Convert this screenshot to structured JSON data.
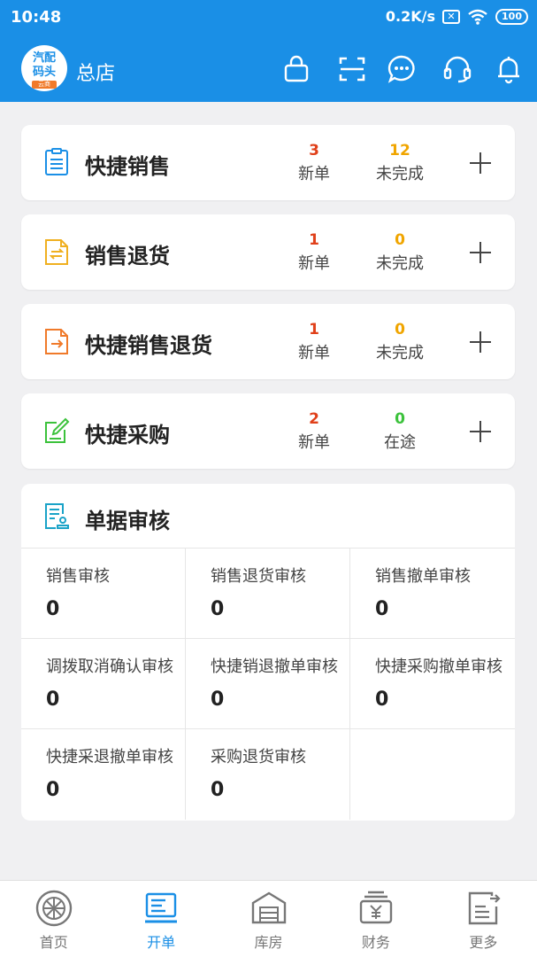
{
  "status_bar": {
    "time": "10:48",
    "net_speed": "0.2K/s",
    "battery": "100"
  },
  "header": {
    "logo": {
      "line1": "汽配",
      "line2": "码头",
      "band": "云商"
    },
    "store_name": "总店",
    "icons": [
      "bag-icon",
      "scan-icon",
      "message-icon",
      "headset-icon",
      "bell-icon"
    ]
  },
  "cards": [
    {
      "title": "快捷销售",
      "stat1": {
        "value": "3",
        "label": "新单"
      },
      "stat2": {
        "value": "12",
        "label": "未完成"
      }
    },
    {
      "title": "销售退货",
      "stat1": {
        "value": "1",
        "label": "新单"
      },
      "stat2": {
        "value": "0",
        "label": "未完成"
      }
    },
    {
      "title": "快捷销售退货",
      "stat1": {
        "value": "1",
        "label": "新单"
      },
      "stat2": {
        "value": "0",
        "label": "未完成"
      }
    },
    {
      "title": "快捷采购",
      "stat1": {
        "value": "2",
        "label": "新单"
      },
      "stat2": {
        "value": "0",
        "label": "在途"
      }
    }
  ],
  "audit": {
    "title": "单据审核",
    "items": [
      {
        "label": "销售审核",
        "value": "0"
      },
      {
        "label": "销售退货审核",
        "value": "0"
      },
      {
        "label": "销售撤单审核",
        "value": "0"
      },
      {
        "label": "调拨取消确认审核",
        "value": "0"
      },
      {
        "label": "快捷销退撤单审核",
        "value": "0"
      },
      {
        "label": "快捷采购撤单审核",
        "value": "0"
      },
      {
        "label": "快捷采退撤单审核",
        "value": "0"
      },
      {
        "label": "采购退货审核",
        "value": "0"
      }
    ]
  },
  "bottom_nav": [
    {
      "label": "首页",
      "icon": "wheel-icon"
    },
    {
      "label": "开单",
      "icon": "order-icon",
      "active": true
    },
    {
      "label": "库房",
      "icon": "warehouse-icon"
    },
    {
      "label": "财务",
      "icon": "finance-icon"
    },
    {
      "label": "更多",
      "icon": "more-icon"
    }
  ],
  "colors": {
    "brand": "#1a8fe6",
    "new_red": "#e0401a",
    "pending_orange": "#f0a500",
    "transit_green": "#3cc23c",
    "background": "#f0f0f2"
  }
}
